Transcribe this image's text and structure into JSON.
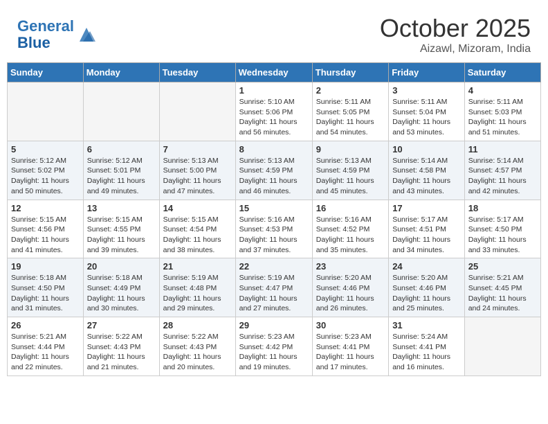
{
  "header": {
    "logo_line1": "General",
    "logo_line2": "Blue",
    "month": "October 2025",
    "location": "Aizawl, Mizoram, India"
  },
  "weekdays": [
    "Sunday",
    "Monday",
    "Tuesday",
    "Wednesday",
    "Thursday",
    "Friday",
    "Saturday"
  ],
  "weeks": [
    [
      {
        "day": "",
        "empty": true
      },
      {
        "day": "",
        "empty": true
      },
      {
        "day": "",
        "empty": true
      },
      {
        "day": "1",
        "sunrise": "5:10 AM",
        "sunset": "5:06 PM",
        "daylight": "11 hours and 56 minutes."
      },
      {
        "day": "2",
        "sunrise": "5:11 AM",
        "sunset": "5:05 PM",
        "daylight": "11 hours and 54 minutes."
      },
      {
        "day": "3",
        "sunrise": "5:11 AM",
        "sunset": "5:04 PM",
        "daylight": "11 hours and 53 minutes."
      },
      {
        "day": "4",
        "sunrise": "5:11 AM",
        "sunset": "5:03 PM",
        "daylight": "11 hours and 51 minutes."
      }
    ],
    [
      {
        "day": "5",
        "sunrise": "5:12 AM",
        "sunset": "5:02 PM",
        "daylight": "11 hours and 50 minutes."
      },
      {
        "day": "6",
        "sunrise": "5:12 AM",
        "sunset": "5:01 PM",
        "daylight": "11 hours and 49 minutes."
      },
      {
        "day": "7",
        "sunrise": "5:13 AM",
        "sunset": "5:00 PM",
        "daylight": "11 hours and 47 minutes."
      },
      {
        "day": "8",
        "sunrise": "5:13 AM",
        "sunset": "4:59 PM",
        "daylight": "11 hours and 46 minutes."
      },
      {
        "day": "9",
        "sunrise": "5:13 AM",
        "sunset": "4:59 PM",
        "daylight": "11 hours and 45 minutes."
      },
      {
        "day": "10",
        "sunrise": "5:14 AM",
        "sunset": "4:58 PM",
        "daylight": "11 hours and 43 minutes."
      },
      {
        "day": "11",
        "sunrise": "5:14 AM",
        "sunset": "4:57 PM",
        "daylight": "11 hours and 42 minutes."
      }
    ],
    [
      {
        "day": "12",
        "sunrise": "5:15 AM",
        "sunset": "4:56 PM",
        "daylight": "11 hours and 41 minutes."
      },
      {
        "day": "13",
        "sunrise": "5:15 AM",
        "sunset": "4:55 PM",
        "daylight": "11 hours and 39 minutes."
      },
      {
        "day": "14",
        "sunrise": "5:15 AM",
        "sunset": "4:54 PM",
        "daylight": "11 hours and 38 minutes."
      },
      {
        "day": "15",
        "sunrise": "5:16 AM",
        "sunset": "4:53 PM",
        "daylight": "11 hours and 37 minutes."
      },
      {
        "day": "16",
        "sunrise": "5:16 AM",
        "sunset": "4:52 PM",
        "daylight": "11 hours and 35 minutes."
      },
      {
        "day": "17",
        "sunrise": "5:17 AM",
        "sunset": "4:51 PM",
        "daylight": "11 hours and 34 minutes."
      },
      {
        "day": "18",
        "sunrise": "5:17 AM",
        "sunset": "4:50 PM",
        "daylight": "11 hours and 33 minutes."
      }
    ],
    [
      {
        "day": "19",
        "sunrise": "5:18 AM",
        "sunset": "4:50 PM",
        "daylight": "11 hours and 31 minutes."
      },
      {
        "day": "20",
        "sunrise": "5:18 AM",
        "sunset": "4:49 PM",
        "daylight": "11 hours and 30 minutes."
      },
      {
        "day": "21",
        "sunrise": "5:19 AM",
        "sunset": "4:48 PM",
        "daylight": "11 hours and 29 minutes."
      },
      {
        "day": "22",
        "sunrise": "5:19 AM",
        "sunset": "4:47 PM",
        "daylight": "11 hours and 27 minutes."
      },
      {
        "day": "23",
        "sunrise": "5:20 AM",
        "sunset": "4:46 PM",
        "daylight": "11 hours and 26 minutes."
      },
      {
        "day": "24",
        "sunrise": "5:20 AM",
        "sunset": "4:46 PM",
        "daylight": "11 hours and 25 minutes."
      },
      {
        "day": "25",
        "sunrise": "5:21 AM",
        "sunset": "4:45 PM",
        "daylight": "11 hours and 24 minutes."
      }
    ],
    [
      {
        "day": "26",
        "sunrise": "5:21 AM",
        "sunset": "4:44 PM",
        "daylight": "11 hours and 22 minutes."
      },
      {
        "day": "27",
        "sunrise": "5:22 AM",
        "sunset": "4:43 PM",
        "daylight": "11 hours and 21 minutes."
      },
      {
        "day": "28",
        "sunrise": "5:22 AM",
        "sunset": "4:43 PM",
        "daylight": "11 hours and 20 minutes."
      },
      {
        "day": "29",
        "sunrise": "5:23 AM",
        "sunset": "4:42 PM",
        "daylight": "11 hours and 19 minutes."
      },
      {
        "day": "30",
        "sunrise": "5:23 AM",
        "sunset": "4:41 PM",
        "daylight": "11 hours and 17 minutes."
      },
      {
        "day": "31",
        "sunrise": "5:24 AM",
        "sunset": "4:41 PM",
        "daylight": "11 hours and 16 minutes."
      },
      {
        "day": "",
        "empty": true
      }
    ]
  ]
}
